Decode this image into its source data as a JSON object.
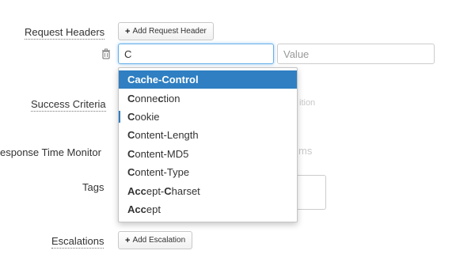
{
  "form": {
    "request_headers_label": "Request Headers",
    "add_request_header_label": "Add Request Header",
    "header_name_value": "C",
    "header_value_placeholder": "Value",
    "success_criteria_label": "Success Criteria",
    "response_time_monitor_label": "esponse Time Monitor",
    "tags_label": "Tags",
    "escalations_label": "Escalations",
    "add_escalation_label": "Add Escalation",
    "behind_dropdown_fragment_1": "ition",
    "behind_dropdown_fragment_2": "ms"
  },
  "autocomplete": {
    "items": [
      {
        "prefix": "Cache-Control",
        "rest": ""
      },
      {
        "prefix": "C",
        "rest": "onne",
        "hl": "c",
        "rest2": "tion"
      },
      {
        "prefix": "C",
        "rest": "ookie"
      },
      {
        "prefix": "C",
        "rest": "ontent-Length"
      },
      {
        "prefix": "C",
        "rest": "ontent-MD5"
      },
      {
        "prefix": "C",
        "rest": "ontent-Type"
      },
      {
        "prefix": "Acc",
        "rest": "ept-",
        "hl": "C",
        "rest2": "harset"
      },
      {
        "prefix": "Acc",
        "rest": "ept"
      }
    ],
    "active_index": 0
  },
  "colors": {
    "accent": "#2f7fc2",
    "focus_border": "#66afe9"
  },
  "icons": {
    "trash": "trash-icon",
    "plus": "plus-icon",
    "help": "question-icon"
  }
}
